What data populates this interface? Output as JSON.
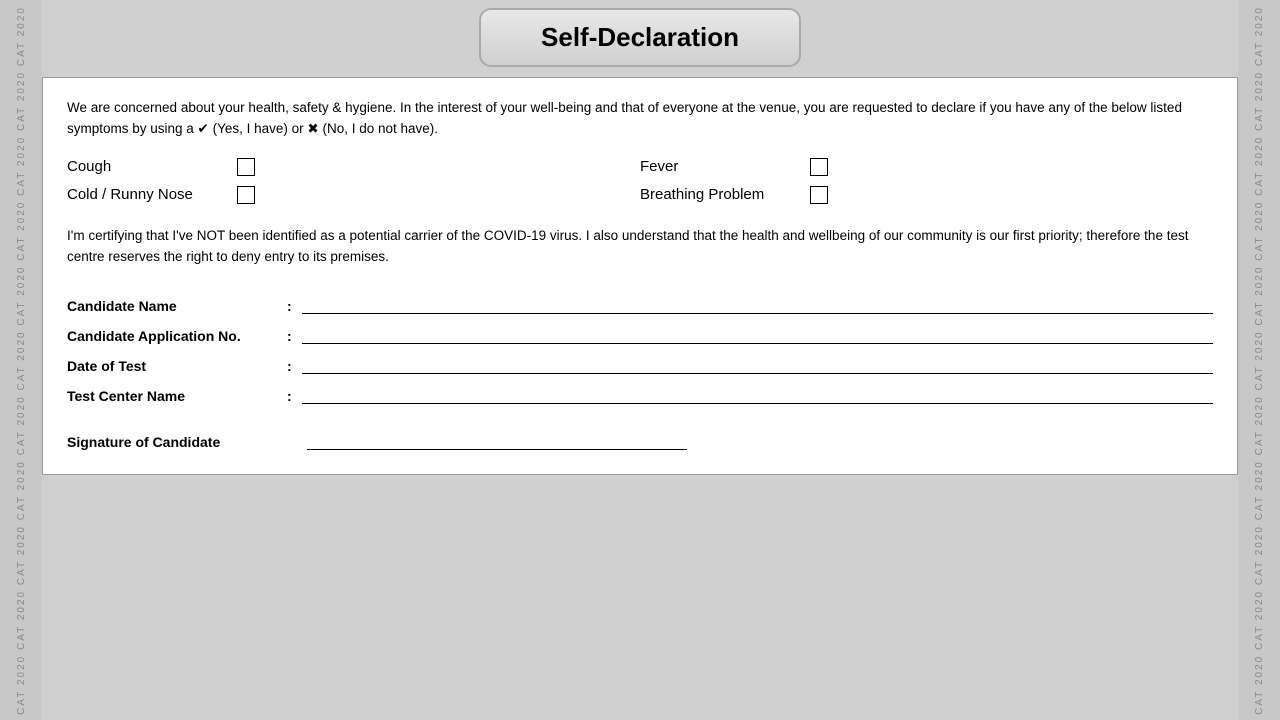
{
  "watermark": {
    "text": "CAT 2020 CAT 2020 CAT 2020 CAT 2020 CAT 2020 CAT 2020 CAT 2020 CAT 2020 CAT 2020 CAT 2020 CAT 2020"
  },
  "title": "Self-Declaration",
  "intro": "We are concerned about your health, safety & hygiene. In the interest of your well-being and that of everyone at the venue, you are requested to declare if you have any of the below listed symptoms by using a  ✔   (Yes, I have) or  ✖  (No, I do not have).",
  "symptoms": [
    {
      "name": "Cough",
      "checked": false
    },
    {
      "name": "Fever",
      "checked": false
    },
    {
      "name": "Cold / Runny Nose",
      "checked": false
    },
    {
      "name": "Breathing Problem",
      "checked": false
    }
  ],
  "certification": "I'm certifying that I've NOT been identified as a potential carrier of the COVID-19 virus. I also understand that the health and wellbeing of our community is our first priority; therefore the test centre reserves the right to deny entry to its premises.",
  "fields": [
    {
      "label": "Candidate Name",
      "colon": ":"
    },
    {
      "label": "Candidate Application No.",
      "colon": ":"
    },
    {
      "label": "Date of Test",
      "colon": ":"
    },
    {
      "label": "Test Center Name",
      "colon": ":"
    }
  ],
  "signature_label": "Signature of Candidate"
}
